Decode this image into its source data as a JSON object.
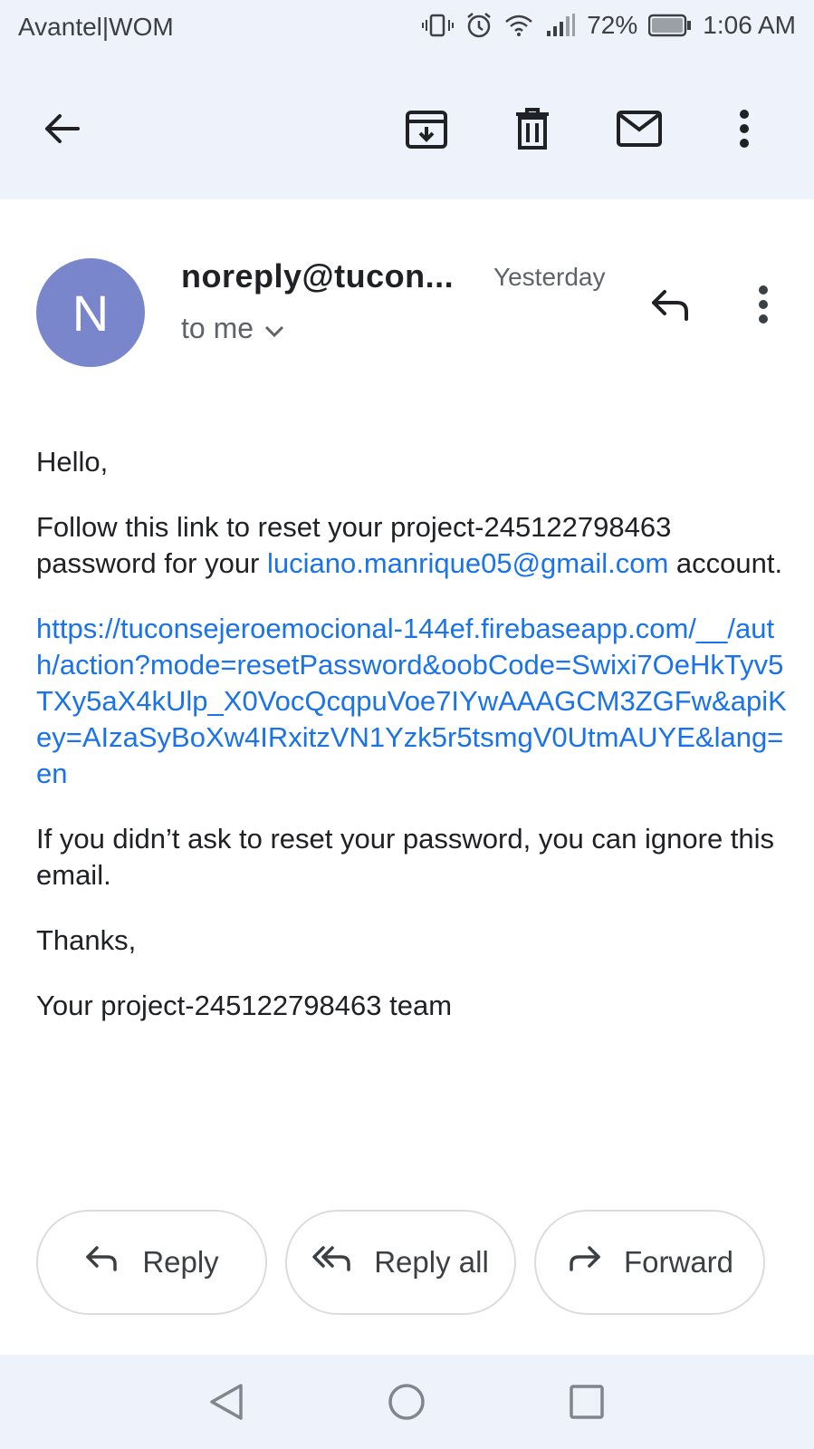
{
  "status_bar": {
    "carrier": "Avantel|WOM",
    "battery": "72%",
    "time": "1:06 AM",
    "icons": [
      "vibrate-icon",
      "alarm-icon",
      "wifi-icon",
      "signal-icon",
      "battery-icon"
    ]
  },
  "toolbar": {
    "icons": [
      "back-arrow-icon",
      "archive-icon",
      "delete-icon",
      "mark-unread-icon",
      "more-vert-icon"
    ]
  },
  "message": {
    "avatar_letter": "N",
    "sender": "noreply@tucon...",
    "date": "Yesterday",
    "recipient": "to me",
    "body": {
      "greeting": "Hello,",
      "line1": "Follow this link to reset your project-245122798463 password for your ",
      "email_link": "luciano.manrique05@gmail.com",
      "line1_end": " account.",
      "url": "https://tuconsejeroemocional-144ef.firebaseapp.com/__/auth/action?mode=resetPassword&oobCode=Swixi7OeHkTyv5TXy5aX4kUlp_X0VocQcqpuVoe7IYwAAAGCM3ZGFw&apiKey=AIzaSyBoXw4IRxitzVN1Yzk5r5tsmgV0UtmAUYE&lang=en",
      "ignore_note": "If you didn’t ask to reset your password, you can ignore this email.",
      "thanks": "Thanks,",
      "signature": "Your project-245122798463 team"
    }
  },
  "actions": {
    "reply": "Reply",
    "reply_all": "Reply all",
    "forward": "Forward"
  },
  "colors": {
    "accent": "#1a73e8",
    "avatar": "#7986cb",
    "app_bar": "#eef2fa"
  }
}
